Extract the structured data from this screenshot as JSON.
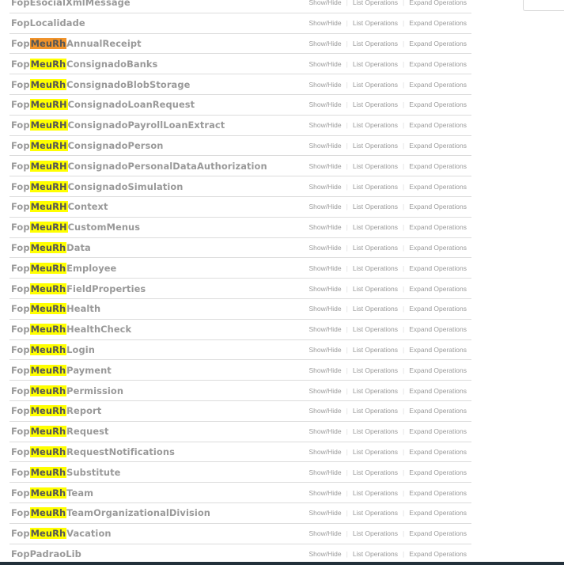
{
  "search_term": "MeuRh",
  "operations": {
    "show_hide": "Show/Hide",
    "list_operations": "List Operations",
    "expand_operations": "Expand Operations"
  },
  "resources": [
    {
      "prefix": "Fop",
      "highlight": "",
      "suffix": "EsocialXmlMessage",
      "current": false
    },
    {
      "prefix": "Fop",
      "highlight": "",
      "suffix": "Localidade",
      "current": false
    },
    {
      "prefix": "Fop",
      "highlight": "MeuRh",
      "suffix": "AnnualReceipt",
      "current": true
    },
    {
      "prefix": "Fop",
      "highlight": "MeuRh",
      "suffix": "ConsignadoBanks",
      "current": false
    },
    {
      "prefix": "Fop",
      "highlight": "MeuRh",
      "suffix": "ConsignadoBlobStorage",
      "current": false
    },
    {
      "prefix": "Fop",
      "highlight": "MeuRH",
      "suffix": "ConsignadoLoanRequest",
      "current": false
    },
    {
      "prefix": "Fop",
      "highlight": "MeuRH",
      "suffix": "ConsignadoPayrollLoanExtract",
      "current": false
    },
    {
      "prefix": "Fop",
      "highlight": "MeuRH",
      "suffix": "ConsignadoPerson",
      "current": false
    },
    {
      "prefix": "Fop",
      "highlight": "MeuRH",
      "suffix": "ConsignadoPersonalDataAuthorization",
      "current": false
    },
    {
      "prefix": "Fop",
      "highlight": "MeuRH",
      "suffix": "ConsignadoSimulation",
      "current": false
    },
    {
      "prefix": "Fop",
      "highlight": "MeuRH",
      "suffix": "Context",
      "current": false
    },
    {
      "prefix": "Fop",
      "highlight": "MeuRH",
      "suffix": "CustomMenus",
      "current": false
    },
    {
      "prefix": "Fop",
      "highlight": "MeuRh",
      "suffix": "Data",
      "current": false
    },
    {
      "prefix": "Fop",
      "highlight": "MeuRh",
      "suffix": "Employee",
      "current": false
    },
    {
      "prefix": "Fop",
      "highlight": "MeuRh",
      "suffix": "FieldProperties",
      "current": false
    },
    {
      "prefix": "Fop",
      "highlight": "MeuRh",
      "suffix": "Health",
      "current": false
    },
    {
      "prefix": "Fop",
      "highlight": "MeuRh",
      "suffix": "HealthCheck",
      "current": false
    },
    {
      "prefix": "Fop",
      "highlight": "MeuRh",
      "suffix": "Login",
      "current": false
    },
    {
      "prefix": "Fop",
      "highlight": "MeuRh",
      "suffix": "Payment",
      "current": false
    },
    {
      "prefix": "Fop",
      "highlight": "MeuRh",
      "suffix": "Permission",
      "current": false
    },
    {
      "prefix": "Fop",
      "highlight": "MeuRh",
      "suffix": "Report",
      "current": false
    },
    {
      "prefix": "Fop",
      "highlight": "MeuRh",
      "suffix": "Request",
      "current": false
    },
    {
      "prefix": "Fop",
      "highlight": "MeuRh",
      "suffix": "RequestNotifications",
      "current": false
    },
    {
      "prefix": "Fop",
      "highlight": "MeuRh",
      "suffix": "Substitute",
      "current": false
    },
    {
      "prefix": "Fop",
      "highlight": "MeuRh",
      "suffix": "Team",
      "current": false
    },
    {
      "prefix": "Fop",
      "highlight": "MeuRh",
      "suffix": "TeamOrganizationalDivision",
      "current": false
    },
    {
      "prefix": "Fop",
      "highlight": "MeuRh",
      "suffix": "Vacation",
      "current": false
    },
    {
      "prefix": "Fop",
      "highlight": "",
      "suffix": "PadraoLib",
      "current": false
    }
  ],
  "colors": {
    "highlight": "#ffff00",
    "current_highlight": "#f0932b",
    "resource_text": "#999999",
    "operation_text": "#9a9a9a",
    "row_border": "#dcdcdc"
  }
}
